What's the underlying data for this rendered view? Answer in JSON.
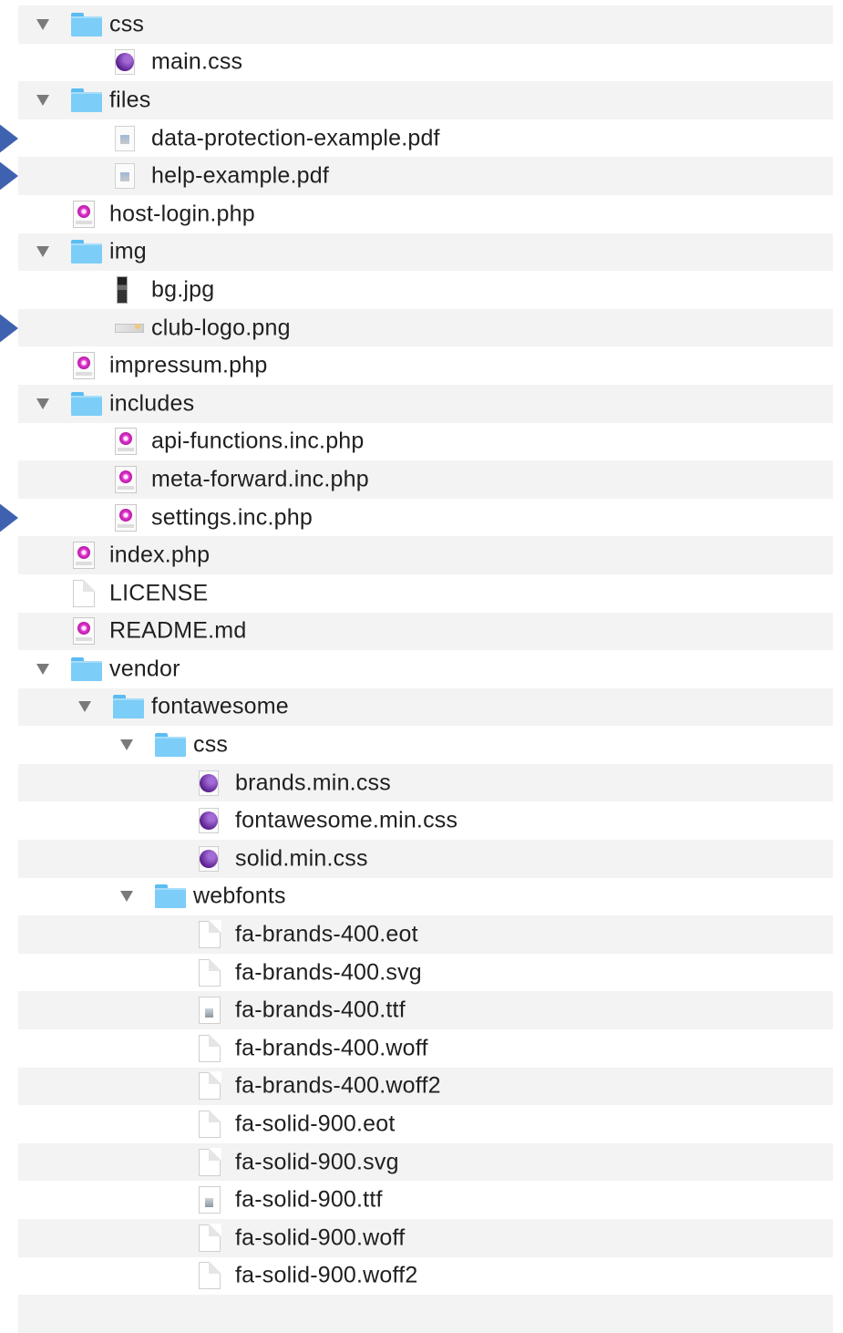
{
  "tree": [
    {
      "label": "css",
      "type": "folder",
      "depth": 0,
      "expanded": true
    },
    {
      "label": "main.css",
      "type": "css",
      "depth": 1
    },
    {
      "label": "files",
      "type": "folder",
      "depth": 0,
      "expanded": true
    },
    {
      "label": "data-protection-example.pdf",
      "type": "pdf",
      "depth": 1,
      "highlighted": true
    },
    {
      "label": "help-example.pdf",
      "type": "pdf",
      "depth": 1,
      "highlighted": true
    },
    {
      "label": "host-login.php",
      "type": "php",
      "depth": 0
    },
    {
      "label": "img",
      "type": "folder",
      "depth": 0,
      "expanded": true
    },
    {
      "label": "bg.jpg",
      "type": "jpg",
      "depth": 1
    },
    {
      "label": "club-logo.png",
      "type": "png",
      "depth": 1,
      "highlighted": true
    },
    {
      "label": "impressum.php",
      "type": "php",
      "depth": 0
    },
    {
      "label": "includes",
      "type": "folder",
      "depth": 0,
      "expanded": true
    },
    {
      "label": "api-functions.inc.php",
      "type": "php",
      "depth": 1
    },
    {
      "label": "meta-forward.inc.php",
      "type": "php",
      "depth": 1
    },
    {
      "label": "settings.inc.php",
      "type": "php",
      "depth": 1,
      "highlighted": true
    },
    {
      "label": "index.php",
      "type": "php",
      "depth": 0
    },
    {
      "label": "LICENSE",
      "type": "doc",
      "depth": 0
    },
    {
      "label": "README.md",
      "type": "php",
      "depth": 0
    },
    {
      "label": "vendor",
      "type": "folder",
      "depth": 0,
      "expanded": true
    },
    {
      "label": "fontawesome",
      "type": "folder",
      "depth": 1,
      "expanded": true
    },
    {
      "label": "css",
      "type": "folder",
      "depth": 2,
      "expanded": true
    },
    {
      "label": "brands.min.css",
      "type": "css",
      "depth": 3
    },
    {
      "label": "fontawesome.min.css",
      "type": "css",
      "depth": 3
    },
    {
      "label": "solid.min.css",
      "type": "css",
      "depth": 3
    },
    {
      "label": "webfonts",
      "type": "folder",
      "depth": 2,
      "expanded": true
    },
    {
      "label": "fa-brands-400.eot",
      "type": "doc",
      "depth": 3
    },
    {
      "label": "fa-brands-400.svg",
      "type": "doc",
      "depth": 3
    },
    {
      "label": "fa-brands-400.ttf",
      "type": "font",
      "depth": 3
    },
    {
      "label": "fa-brands-400.woff",
      "type": "doc",
      "depth": 3
    },
    {
      "label": "fa-brands-400.woff2",
      "type": "doc",
      "depth": 3
    },
    {
      "label": "fa-solid-900.eot",
      "type": "doc",
      "depth": 3
    },
    {
      "label": "fa-solid-900.svg",
      "type": "doc",
      "depth": 3
    },
    {
      "label": "fa-solid-900.ttf",
      "type": "font",
      "depth": 3
    },
    {
      "label": "fa-solid-900.woff",
      "type": "doc",
      "depth": 3
    },
    {
      "label": "fa-solid-900.woff2",
      "type": "doc",
      "depth": 3
    }
  ],
  "colors": {
    "stripe": "#f3f3f3",
    "folder": "#7ccdf7",
    "arrow": "#4472c4"
  }
}
